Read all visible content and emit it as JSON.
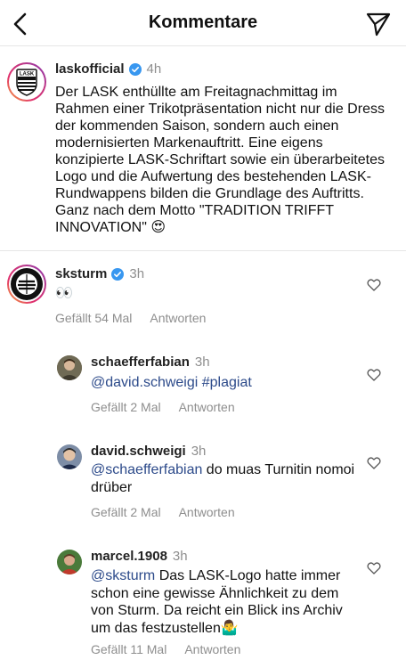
{
  "header": {
    "title": "Kommentare",
    "back_icon": "chevron-left-icon",
    "send_icon": "paper-plane-icon"
  },
  "caption": {
    "username": "laskofficial",
    "time": "4h",
    "avatar_text": "LASK",
    "text": "Der LASK enthüllte am Freitagnachmittag im Rahmen einer Trikotpräsentation nicht nur die Dress der kommenden Saison, sondern auch einen modernisierten Markenauftritt. Eine eigens konzipierte LASK-Schriftart sowie ein überarbeitetes Logo und die Aufwertung des bestehenden LASK-Rundwappens bilden die Grundlage des Auftritts. Ganz nach dem Motto \"TRADITION TRIFFT INNOVATION\" 😍"
  },
  "comments": [
    {
      "username": "sksturm",
      "time": "3h",
      "verified": true,
      "mention": "",
      "text": "👀",
      "likes": "Gefällt 54 Mal",
      "reply": "Antworten"
    },
    {
      "username": "schaefferfabian",
      "time": "3h",
      "mention": "@david.schweigi #plagiat",
      "text": "",
      "likes": "Gefällt 2 Mal",
      "reply": "Antworten"
    },
    {
      "username": "david.schweigi",
      "time": "3h",
      "mention": "@schaefferfabian",
      "text": " do muas Turnitin nomoi drüber",
      "likes": "Gefällt 2 Mal",
      "reply": "Antworten"
    },
    {
      "username": "marcel.1908",
      "time": "3h",
      "mention": "@sksturm",
      "text": " Das LASK-Logo hatte immer schon eine gewisse Ähnlichkeit zu dem von Sturm. Da reicht ein Blick ins Archiv um das festzustellen🤷‍♂️",
      "likes": "Gefällt 11 Mal",
      "reply": "Antworten"
    }
  ],
  "colors": {
    "accent_link": "#2c4a8a",
    "verified_blue": "#3897f0",
    "muted": "#8e8e8e"
  }
}
